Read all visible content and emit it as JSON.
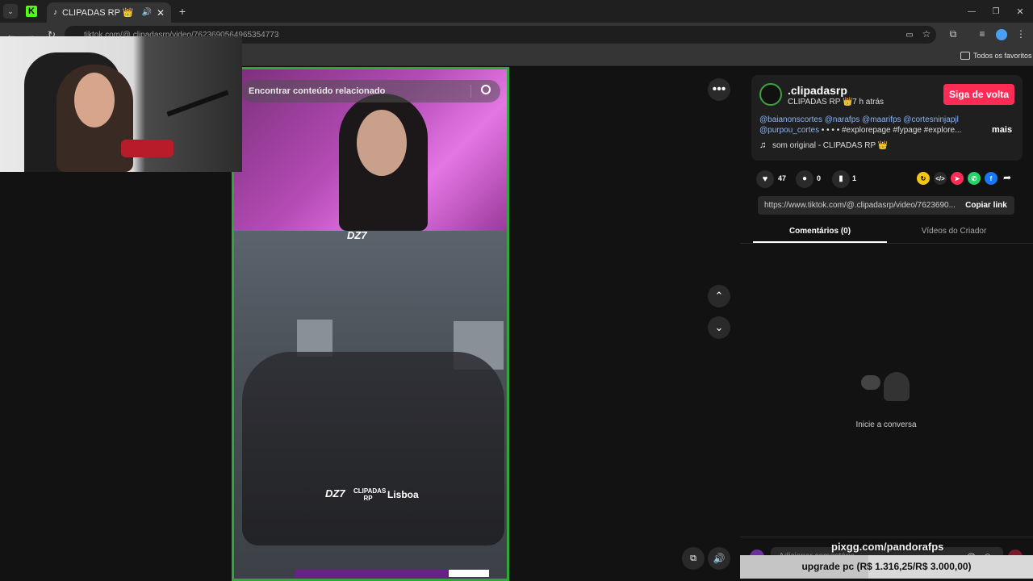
{
  "browser": {
    "tab_title": "CLIPADAS RP 👑 (@.clipad",
    "url": "tiktok.com/@.clipadasrp/video/7623690564965354773",
    "bookmarks_label": "Todos os favoritos"
  },
  "video": {
    "search_placeholder": "Encontrar conteúdo relacionado",
    "watermark": "DZ7",
    "logos": [
      "DZ7",
      "CLIPADAS RP",
      "Lisboa"
    ]
  },
  "post": {
    "username": ".clipadasrp",
    "display_name": "CLIPADAS RP 👑",
    "time": "· 7 h atrás",
    "follow_label": "Siga de volta",
    "caption_mentions": "@baianonscortes @narafps @maarifps @cortesninjapjl @purpou_cortes",
    "caption_line1": "@baianonscortes @narafps @maarifps @cortesninjapjl",
    "caption_line2_mention": "@purpou_cortes",
    "caption_line2_rest": " • • • • #explorepage #fypage #explore...",
    "more_label": "mais",
    "sound": "som original - CLIPADAS RP 👑",
    "likes": "47",
    "comments": "0",
    "saves": "1",
    "link": "https://www.tiktok.com/@.clipadasrp/video/7623690...",
    "copy_link_label": "Copiar link"
  },
  "tabs": {
    "comments": "Comentários (0)",
    "creator_videos": "Vídeos do Criador"
  },
  "empty_state": "Inicie a conversa",
  "comment_input_placeholder": "Adicionar comentário...",
  "overlay": {
    "handle": "pixgg.com/pandorafps",
    "goal": "upgrade pc (R$ 1.316,25/R$ 3.000,00)",
    "goal_progress": 0.439
  },
  "colors": {
    "accent": "#fe2c55",
    "mention": "#8ab4f8",
    "video_border": "#2fa83a"
  }
}
